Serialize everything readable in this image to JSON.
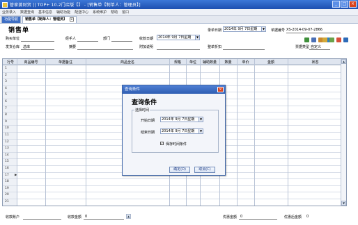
{
  "window": {
    "title": "管家婆财贸 || TOP+ 10.2门店版【】 - [销售单【制单人：管理员】]",
    "buttons": [
      "_",
      "□",
      "×"
    ]
  },
  "menu": [
    "业务录入",
    "数据查询",
    "基本信息",
    "辅助功能",
    "配送中心",
    "系统维护",
    "帮助",
    "窗口"
  ],
  "tabs": {
    "home": "功能导航",
    "active": "销售单【制单人：管理员】",
    "close": "×"
  },
  "form": {
    "title": "销售单",
    "record_date_label": "录单日期",
    "record_date": "2014年 9月 7日星期",
    "doc_no_label": "单据编号",
    "doc_no": "XS-2014-09-07-2866",
    "buyer_label": "购买单位",
    "handler_label": "经手人",
    "dept_label": "部门",
    "receive_date_label": "收款日期",
    "receive_date": "2014年 9月 7日星期",
    "warehouse_label": "发货仓库",
    "warehouse": "总库",
    "summary_label": "摘要",
    "extra_label": "附加说明",
    "discount_label": "整单折扣",
    "doc_type_label": "票据类型",
    "doc_type": "自定义"
  },
  "grid": {
    "columns": [
      "行号",
      "商品编号",
      "单据备注",
      "商品全名",
      "规格",
      "单位",
      "辅助数量",
      "数量",
      "单价",
      "金额",
      "状态"
    ],
    "rows": [
      "1",
      "2",
      "3",
      "4",
      "5",
      "6",
      "7",
      "8",
      "9",
      "10",
      "11",
      "12",
      "13",
      "14",
      "15",
      "16",
      "17",
      "18",
      "19",
      "20",
      "21",
      "合计"
    ],
    "current_row": "17"
  },
  "footer": {
    "account_label": "收款账户",
    "amount_label": "收款金额",
    "amount_value": "0",
    "pay_label": "优惠金额",
    "pay_value": "0",
    "final_label": "优惠后金额",
    "final_value": "0"
  },
  "dialog": {
    "title": "查询条件",
    "heading": "查询条件",
    "group_label": "选择时间",
    "start_label": "开始日期",
    "start_value": "2014年 9月 7日星期",
    "end_label": "结束日期",
    "end_value": "2014年 9月 7日星期",
    "save_label": "保存时间条件",
    "save_checked": true,
    "ok_label": "确定(O)",
    "cancel_label": "取消(C)",
    "close": "×"
  },
  "colors": {
    "titlebar": "#1d4fb0",
    "grid_header": "#dfe5ef",
    "dialog_title": "#2f5db3"
  }
}
